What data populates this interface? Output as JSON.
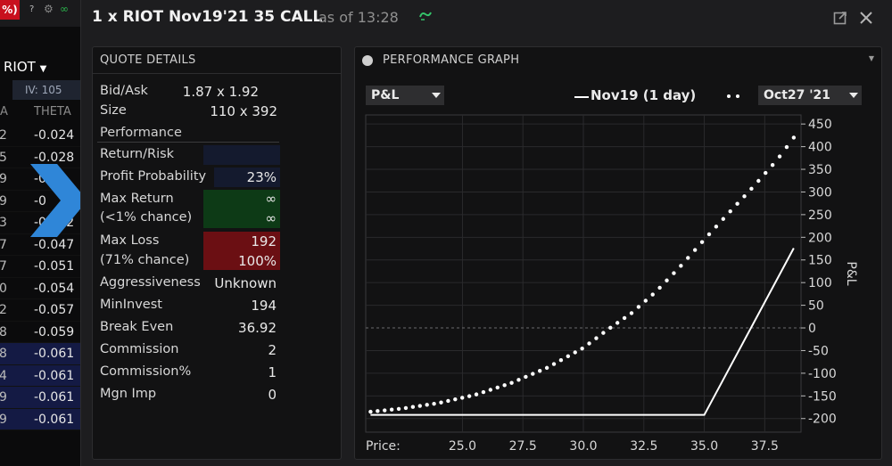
{
  "background_app": {
    "badge_text": "%)",
    "help_text": "?",
    "symbol": "RIOT",
    "iv_label": "IV: 105",
    "col_a": "A",
    "col_theta": "THETA",
    "rows": [
      {
        "k": "2",
        "v": "-0.024",
        "hl": false
      },
      {
        "k": "5",
        "v": "-0.028",
        "hl": false
      },
      {
        "k": "9",
        "v": "-0.0",
        "hl": false
      },
      {
        "k": "9",
        "v": "-0",
        "hl": false
      },
      {
        "k": "3",
        "v": "-0.042",
        "hl": false
      },
      {
        "k": "7",
        "v": "-0.047",
        "hl": false
      },
      {
        "k": "7",
        "v": "-0.051",
        "hl": false
      },
      {
        "k": "0",
        "v": "-0.054",
        "hl": false
      },
      {
        "k": "2",
        "v": "-0.057",
        "hl": false
      },
      {
        "k": "8",
        "v": "-0.059",
        "hl": false
      },
      {
        "k": "8",
        "v": "-0.061",
        "hl": true
      },
      {
        "k": "4",
        "v": "-0.061",
        "hl": true
      },
      {
        "k": "9",
        "v": "-0.061",
        "hl": true
      },
      {
        "k": "9",
        "v": "-0.061",
        "hl": true
      }
    ]
  },
  "window": {
    "title": "1 x RIOT Nov19'21 35 CALL",
    "as_of": "as of 13:28"
  },
  "quote_details": {
    "header": "QUOTE DETAILS",
    "bid_ask_label": "Bid/Ask",
    "bid_ask_value": "1.87 x 1.92",
    "size_label": "Size",
    "size_value": "110 x 392",
    "performance_label": "Performance",
    "return_risk_label": "Return/Risk",
    "profit_probability_label": "Profit Probability",
    "profit_probability_value": "23%",
    "max_return_label": "Max Return",
    "max_return_sub": "(<1% chance)",
    "max_return_value": "∞",
    "max_return_value2": "∞",
    "max_loss_label": "Max Loss",
    "max_loss_sub": "(71% chance)",
    "max_loss_value": "192",
    "max_loss_pct": "100%",
    "aggressiveness_label": "Aggressiveness",
    "aggressiveness_value": "Unknown",
    "mininvest_label": "MinInvest",
    "mininvest_value": "194",
    "break_even_label": "Break Even",
    "break_even_value": "36.92",
    "commission_label": "Commission",
    "commission_value": "2",
    "commission_pct_label": "Commission%",
    "commission_pct_value": "1",
    "mgn_imp_label": "Mgn Imp",
    "mgn_imp_value": "0"
  },
  "performance_graph": {
    "header": "PERFORMANCE GRAPH",
    "metric_select": "P&L",
    "legend_solid": "Nov19 (1 day)",
    "date_select": "Oct27 '21",
    "price_label": "Price:"
  },
  "chart_data": {
    "type": "line",
    "xlabel": "Price:",
    "ylabel": "P&L",
    "xlim": [
      21.0,
      39.0
    ],
    "ylim": [
      -230,
      470
    ],
    "x_ticks": [
      25.0,
      27.5,
      30.0,
      32.5,
      35.0,
      37.5
    ],
    "y_ticks": [
      -200,
      -150,
      -100,
      -50,
      0,
      50,
      100,
      150,
      200,
      250,
      300,
      350,
      400,
      450
    ],
    "grid": true,
    "series": [
      {
        "name": "Nov19 (1 day)",
        "style": "solid",
        "color": "#ffffff",
        "x": [
          21.2,
          35.0,
          38.7
        ],
        "y": [
          -192,
          -192,
          176
        ]
      },
      {
        "name": "Oct27 '21",
        "style": "dotted",
        "color": "#ffffff",
        "x": [
          21.2,
          22.5,
          24.0,
          25.5,
          27.0,
          28.5,
          30.0,
          31.0,
          32.0,
          33.0,
          34.0,
          35.0,
          36.0,
          37.0,
          38.0,
          38.7
        ],
        "y": [
          -185,
          -178,
          -166,
          -148,
          -122,
          -88,
          -44,
          -4,
          33,
          80,
          135,
          195,
          253,
          310,
          370,
          420
        ]
      }
    ]
  },
  "colors": {
    "max_return_bg": "#0d3a16",
    "max_loss_bg": "#6b0f13",
    "accent_blue": "#2f86d8"
  }
}
